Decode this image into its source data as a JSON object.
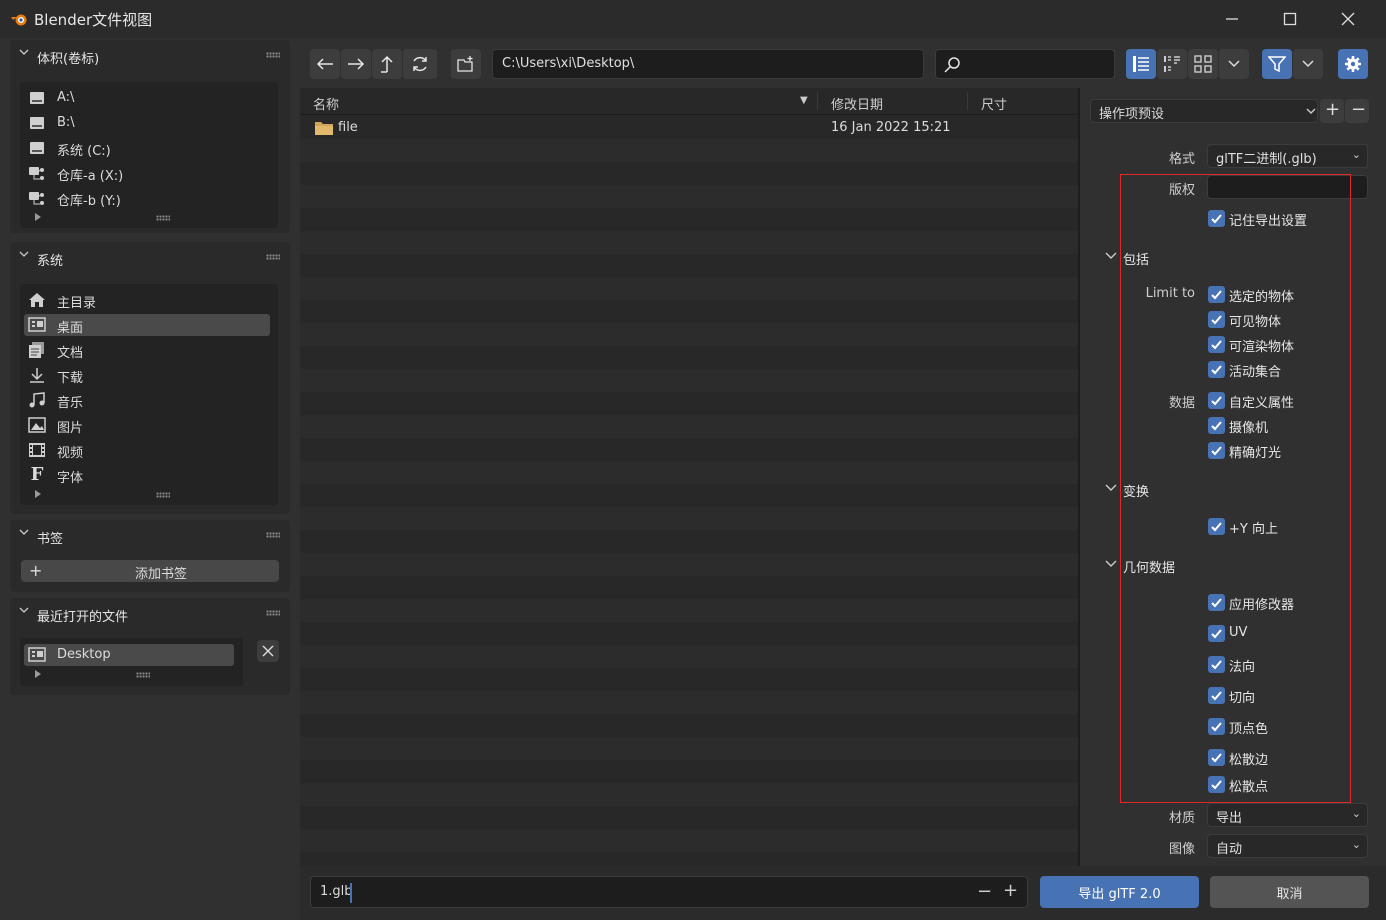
{
  "window": {
    "title": "Blender文件视图",
    "minimize_icon": "minimize-icon",
    "maximize_icon": "maximize-icon",
    "close_icon": "close-icon"
  },
  "sidebar": {
    "volumes": {
      "title": "体积(卷标)",
      "items": [
        {
          "label": "A:\\",
          "icon": "drive-icon"
        },
        {
          "label": "B:\\",
          "icon": "drive-icon"
        },
        {
          "label": "系统 (C:)",
          "icon": "drive-icon"
        },
        {
          "label": "仓库-a (X:)",
          "icon": "network-drive-icon"
        },
        {
          "label": "仓库-b (Y:)",
          "icon": "network-drive-icon"
        }
      ]
    },
    "system": {
      "title": "系统",
      "selected": "桌面",
      "items": [
        {
          "label": "主目录",
          "icon": "home-icon"
        },
        {
          "label": "桌面",
          "icon": "desktop-icon"
        },
        {
          "label": "文档",
          "icon": "documents-icon"
        },
        {
          "label": "下载",
          "icon": "download-icon"
        },
        {
          "label": "音乐",
          "icon": "music-icon"
        },
        {
          "label": "图片",
          "icon": "image-icon"
        },
        {
          "label": "视频",
          "icon": "video-icon"
        },
        {
          "label": "字体",
          "icon": "font-icon"
        }
      ]
    },
    "bookmarks": {
      "title": "书签",
      "add_label": "添加书签"
    },
    "recent": {
      "title": "最近打开的文件",
      "items": [
        {
          "label": "Desktop",
          "icon": "desktop-icon"
        }
      ]
    }
  },
  "toolbar": {
    "path": "C:\\Users\\xi\\Desktop\\",
    "search_value": ""
  },
  "filelist": {
    "columns": [
      "名称",
      "修改日期",
      "尺寸"
    ],
    "rows": [
      {
        "name": "file",
        "date": "16 Jan 2022 15:21",
        "size": ""
      }
    ]
  },
  "operator": {
    "preset_label": "操作项预设",
    "format_label": "格式",
    "format_value": "glTF二进制(.glb)",
    "copyright_label": "版权",
    "copyright_value": "",
    "remember_label": "记住导出设置",
    "include": {
      "title": "包括",
      "limit_to_label": "Limit to",
      "limit_items": [
        "选定的物体",
        "可见物体",
        "可渲染物体",
        "活动集合"
      ],
      "data_label": "数据",
      "data_items": [
        "自定义属性",
        "摄像机",
        "精确灯光"
      ]
    },
    "transform": {
      "title": "变换",
      "items": [
        "+Y 向上"
      ]
    },
    "geometry": {
      "title": "几何数据",
      "items": [
        "应用修改器",
        "UV",
        "法向",
        "切向",
        "顶点色",
        "松散边",
        "松散点"
      ]
    },
    "material_label": "材质",
    "material_value": "导出",
    "image_label": "图像",
    "image_value": "自动"
  },
  "footer": {
    "filename": "1.glb",
    "export_label": "导出 glTF 2.0",
    "cancel_label": "取消"
  },
  "colors": {
    "accent": "#4772b3",
    "highlight_box": "#e0282a",
    "folder": "#d2a65a"
  }
}
